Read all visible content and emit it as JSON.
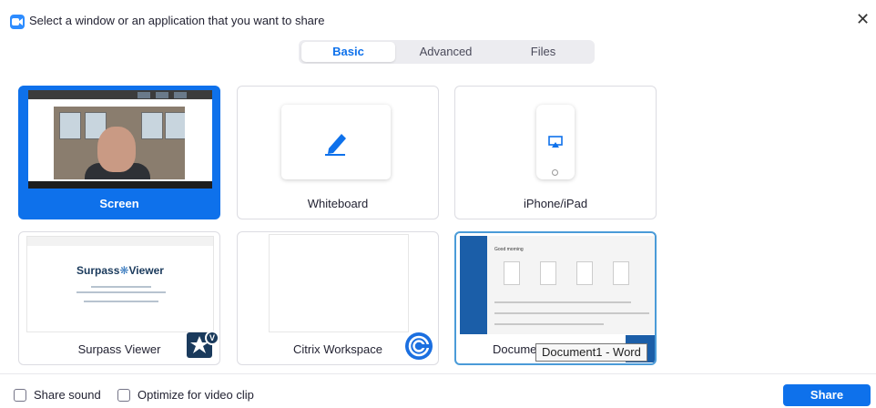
{
  "window": {
    "title": "Select a window or an application that you want to share",
    "app_icon": "zoom-camera-icon",
    "close_glyph": "✕"
  },
  "tabs": [
    {
      "label": "Basic",
      "active": true
    },
    {
      "label": "Advanced",
      "active": false
    },
    {
      "label": "Files",
      "active": false
    }
  ],
  "tiles": [
    {
      "label": "Screen",
      "selected": true
    },
    {
      "label": "Whiteboard",
      "icon": "pen-icon"
    },
    {
      "label": "iPhone/iPad",
      "icon": "airplay-icon"
    },
    {
      "label": "Surpass Viewer",
      "icon": "surpass-viewer-icon",
      "thumb_title": "Surpass",
      "thumb_title_2": "Viewer"
    },
    {
      "label": "Citrix Workspace",
      "icon": "citrix-icon"
    },
    {
      "label": "Docume",
      "icon": "word-icon",
      "tooltip": "Document1 - Word",
      "thumb_title": "Good morning"
    }
  ],
  "footer": {
    "share_sound": "Share sound",
    "optimize_video": "Optimize for video clip",
    "share_button": "Share"
  },
  "colors": {
    "accent": "#0e71eb",
    "tab_bg": "#ececf0",
    "tile_border": "#dcdce2"
  }
}
